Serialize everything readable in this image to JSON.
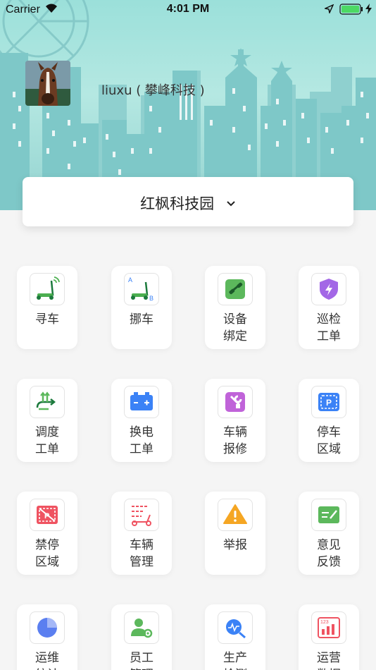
{
  "status_bar": {
    "carrier": "Carrier",
    "time": "4:01 PM"
  },
  "profile": {
    "username": "liuxu ( 攀峰科技 )"
  },
  "park_selector": {
    "name": "红枫科技园"
  },
  "menu": [
    {
      "id": "find-car",
      "line1": "寻车",
      "line2": "",
      "icon": "scooter-signal-icon",
      "color": "#4caf50"
    },
    {
      "id": "move-car",
      "line1": "挪车",
      "line2": "",
      "icon": "scooter-move-icon",
      "color": "#4caf50"
    },
    {
      "id": "device-bind",
      "line1": "设备",
      "line2": "绑定",
      "icon": "link-icon",
      "color": "#5cb85c"
    },
    {
      "id": "patrol-order",
      "line1": "巡检",
      "line2": "工单",
      "icon": "shield-bolt-icon",
      "color": "#a367e6"
    },
    {
      "id": "dispatch-order",
      "line1": "调度",
      "line2": "工单",
      "icon": "dispatch-arrows-icon",
      "color": "#5cb85c"
    },
    {
      "id": "battery-order",
      "line1": "换电",
      "line2": "工单",
      "icon": "battery-icon",
      "color": "#3b82f6"
    },
    {
      "id": "repair",
      "line1": "车辆",
      "line2": "报修",
      "icon": "wrench-icon",
      "color": "#c063d9"
    },
    {
      "id": "parking-area",
      "line1": "停车",
      "line2": "区域",
      "icon": "parking-icon",
      "color": "#3b82f6"
    },
    {
      "id": "no-parking",
      "line1": "禁停",
      "line2": "区域",
      "icon": "no-parking-icon",
      "color": "#ef5361"
    },
    {
      "id": "vehicle-mgmt",
      "line1": "车辆",
      "line2": "管理",
      "icon": "vehicle-list-icon",
      "color": "#ef5361"
    },
    {
      "id": "report",
      "line1": "举报",
      "line2": "",
      "icon": "warning-icon",
      "color": "#f5a623"
    },
    {
      "id": "feedback",
      "line1": "意见",
      "line2": "反馈",
      "icon": "feedback-edit-icon",
      "color": "#5cb85c"
    },
    {
      "id": "ops-stats",
      "line1": "运维",
      "line2": "统计",
      "icon": "pie-chart-icon",
      "color": "#5b7ff0"
    },
    {
      "id": "staff",
      "line1": "员工",
      "line2": "管理",
      "icon": "staff-gear-icon",
      "color": "#5cb85c"
    },
    {
      "id": "production",
      "line1": "生产",
      "line2": "检测",
      "icon": "monitor-search-icon",
      "color": "#3b82f6"
    },
    {
      "id": "operations",
      "line1": "运营",
      "line2": "数据",
      "icon": "bar-chart-123-icon",
      "color": "#ef5361"
    }
  ]
}
